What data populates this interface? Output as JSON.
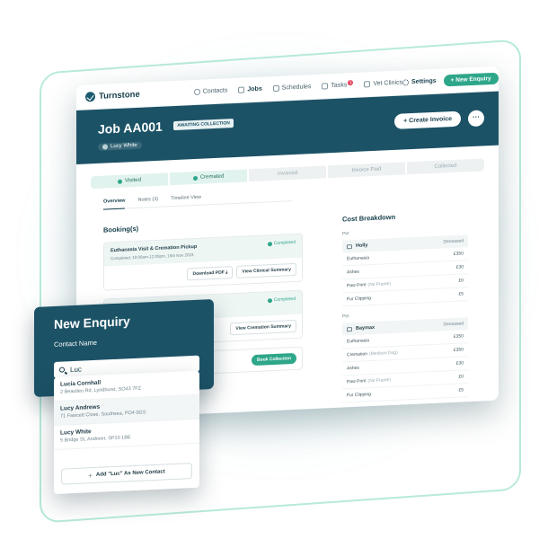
{
  "nav": {
    "brand": "Turnstone",
    "links": [
      "Contacts",
      "Jobs",
      "Schedules",
      "Tasks",
      "Vet Clinics"
    ],
    "tasks_badge": "1",
    "settings": "Settings",
    "new_enquiry": "New Enquiry"
  },
  "header": {
    "job_title": "Job AA001",
    "status": "AWAITING COLLECTION",
    "owner": "Lucy White",
    "create_invoice": "Create Invoice",
    "more": "···"
  },
  "steps": [
    {
      "label": "Visited",
      "done": true
    },
    {
      "label": "Cremated",
      "done": true
    },
    {
      "label": "Invoiced",
      "done": false
    },
    {
      "label": "Invoice Paid",
      "done": false
    },
    {
      "label": "Collected",
      "done": false
    }
  ],
  "tabs": [
    "Overview",
    "Notes (3)",
    "Timeline View"
  ],
  "bookings": {
    "title": "Booking(s)",
    "items": [
      {
        "name": "Euthanasia Visit & Cremation Pickup",
        "sub": "Completed: 10:00am-12:00pm, 15th Nov 2023",
        "status": "Completed",
        "actions": [
          "Download PDF",
          "View Clinical Summary"
        ]
      },
      {
        "name": "Cremation",
        "sub": "Completed: 17th Nov 2023",
        "status": "Completed",
        "actions": [
          "View Cremation Summary"
        ]
      }
    ],
    "book_collection": "Book Collection"
  },
  "cost": {
    "title": "Cost Breakdown",
    "pet_label": "Pet",
    "pets": [
      {
        "name": "Holly",
        "status": "Deceased",
        "lines": [
          {
            "label": "Euthanasia",
            "sub": "",
            "amount": "£350"
          },
          {
            "label": "Ashes",
            "sub": "",
            "amount": "£30"
          },
          {
            "label": "Paw Print",
            "sub": "(No Frame)",
            "amount": "£0"
          },
          {
            "label": "Fur Clipping",
            "sub": "",
            "amount": "£5"
          }
        ]
      },
      {
        "name": "Baymax",
        "status": "Deceased",
        "lines": [
          {
            "label": "Euthanasia",
            "sub": "",
            "amount": "£350"
          },
          {
            "label": "Cremation",
            "sub": "(Medium Dog)",
            "amount": "£350"
          },
          {
            "label": "Ashes",
            "sub": "",
            "amount": "£30"
          },
          {
            "label": "Paw Print",
            "sub": "(No Frame)",
            "amount": "£0"
          },
          {
            "label": "Fur Clipping",
            "sub": "",
            "amount": "£5"
          }
        ]
      }
    ]
  },
  "enquiry": {
    "title": "New Enquiry",
    "label": "Contact Name",
    "search_value": "Luc",
    "results": [
      {
        "name": "Lucia Cornhall",
        "address": "2 Beaulieu Rd, Lyndhurst, SO43 7FZ"
      },
      {
        "name": "Lucy Andrews",
        "address": "71 Fawcett Close, Southsea, PO4 0GS"
      },
      {
        "name": "Lucy White",
        "address": "5 Bridge St, Andover, SP10 1BE"
      }
    ],
    "add_contact": "Add \"Luc\" As New Contact"
  },
  "colors": {
    "brand": "#1c5266",
    "accent": "#2ea68a"
  }
}
